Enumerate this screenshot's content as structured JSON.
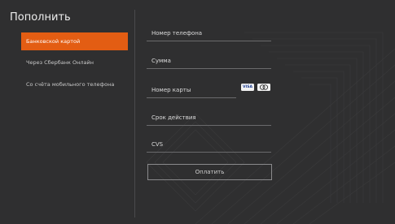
{
  "page": {
    "title": "Пополнить"
  },
  "menu": {
    "items": [
      {
        "label": "Банковской картой",
        "active": true
      },
      {
        "label": "Через Сбербанк Онлайн",
        "active": false
      },
      {
        "label": "Со счёта мобильного телефона",
        "active": false
      }
    ]
  },
  "form": {
    "phone_label": "Номер телефона",
    "amount_label": "Сумма",
    "card_number_label": "Номер карты",
    "expiry_label": "Срок действия",
    "cvs_label": "CVS",
    "card_logos": {
      "visa": "VISA",
      "mastercard": "mastercard-icon"
    },
    "submit_label": "Оплатить"
  },
  "colors": {
    "background": "#2f2f30",
    "accent": "#e35d13"
  }
}
